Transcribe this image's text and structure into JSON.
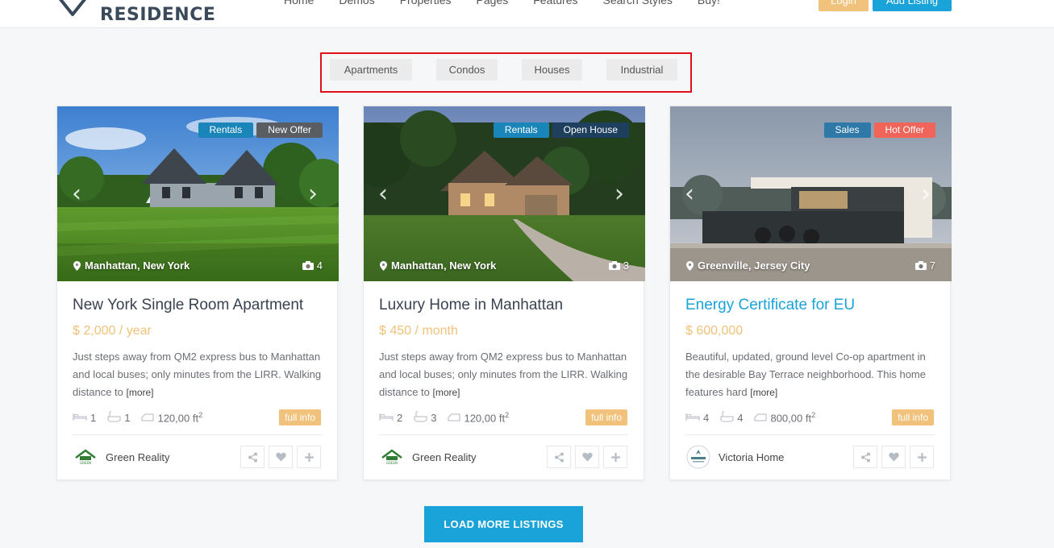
{
  "header": {
    "logo_text": "RESIDENCE",
    "nav": [
      "Home",
      "Demos",
      "Properties",
      "Pages",
      "Features",
      "Search Styles",
      "Buy!"
    ],
    "login_label": "Login",
    "add_listing_label": "Add Listing"
  },
  "filters": [
    "Apartments",
    "Condos",
    "Houses",
    "Industrial"
  ],
  "listings": [
    {
      "badges": [
        {
          "label": "Rentals",
          "color": "#1a85b8"
        },
        {
          "label": "New Offer",
          "color": "#5a5e63"
        }
      ],
      "location": "Manhattan, New York",
      "photo_count": "4",
      "title": "New York Single Room Apartment",
      "price": "$ 2,000 / year",
      "description": "Just steps away from QM2 express bus to Manhattan and local buses; only minutes from the LIRR. Walking distance to",
      "more": "[more]",
      "beds": "1",
      "baths": "1",
      "area": "120,00 ft",
      "area_exp": "2",
      "full_info": "full info",
      "agent": "Green Reality"
    },
    {
      "badges": [
        {
          "label": "Rentals",
          "color": "#1a85b8"
        },
        {
          "label": "Open House",
          "color": "#1f3f5e"
        }
      ],
      "location": "Manhattan, New York",
      "photo_count": "3",
      "title": "Luxury Home in Manhattan",
      "price": "$ 450 / month",
      "description": "Just steps away from QM2 express bus to Manhattan and local buses; only minutes from the LIRR. Walking distance to",
      "more": "[more]",
      "beds": "2",
      "baths": "3",
      "area": "120,00 ft",
      "area_exp": "2",
      "full_info": "full info",
      "agent": "Green Reality"
    },
    {
      "badges": [
        {
          "label": "Sales",
          "color": "#2f79a8"
        },
        {
          "label": "Hot Offer",
          "color": "#f0645a"
        }
      ],
      "location": "Greenville, Jersey City",
      "photo_count": "7",
      "title": "Energy Certificate for EU",
      "price": "$ 600,000",
      "description": "Beautiful, updated, ground level Co-op apartment in the desirable Bay Terrace neighborhood. This home features hard",
      "more": "[more]",
      "beds": "4",
      "baths": "4",
      "area": "800,00 ft",
      "area_exp": "2",
      "full_info": "full info",
      "agent": "Victoria Home"
    }
  ],
  "load_more_label": "LOAD MORE LISTINGS",
  "colors": {
    "accent": "#1aa3d8",
    "price": "#f0c27b",
    "highlight_border": "#e0101b"
  }
}
